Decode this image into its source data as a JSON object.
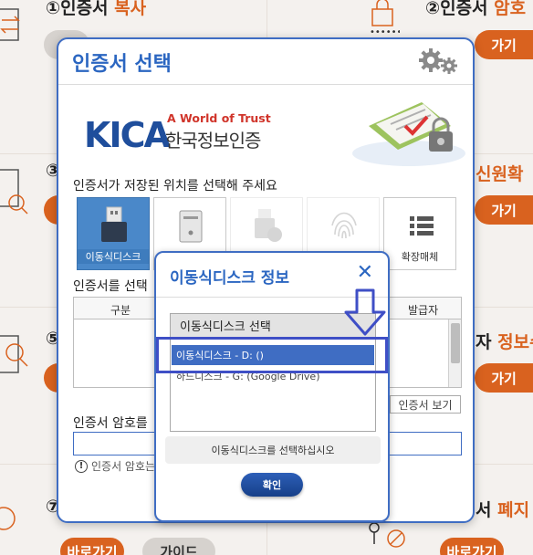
{
  "background": {
    "cells": [
      {
        "num": "①",
        "title": "인증서 ",
        "accent": "복사"
      },
      {
        "num": "②",
        "title": "인증서 ",
        "accent": "암호"
      },
      {
        "num": "③",
        "title": "",
        "accent": ""
      },
      {
        "num": "",
        "title": "",
        "accent": "신원확"
      },
      {
        "num": "⑤",
        "title": "",
        "accent": ""
      },
      {
        "num": "",
        "title": "자 ",
        "accent": "정보수"
      },
      {
        "num": "⑦",
        "title": "",
        "accent": ""
      },
      {
        "num": "",
        "title": "서 ",
        "accent": "폐지"
      }
    ],
    "buttons": {
      "shortcut": "바로가기",
      "guide": "가이드",
      "partial_right": "가기"
    }
  },
  "modal": {
    "title": "인증서 선택",
    "brand": {
      "logo_text": "KICA",
      "slogan": "A World of Trust",
      "org_name": "한국정보인증"
    },
    "location_prompt": "인증서가 저장된 위치를 선택해 주세요",
    "locations": [
      {
        "label": "이동식디스크",
        "icon": "usb-drive-icon",
        "state": "selected"
      },
      {
        "label": "",
        "icon": "hard-disk-icon",
        "state": "normal"
      },
      {
        "label": "",
        "icon": "security-token-icon",
        "state": "disabled"
      },
      {
        "label": "",
        "icon": "fingerprint-icon",
        "state": "disabled"
      },
      {
        "label": "확장매체",
        "icon": "list-icon",
        "state": "normal"
      }
    ],
    "cert_list_label": "인증서를 선택",
    "table_headers": {
      "col1": "구분",
      "col_last": "발급자"
    },
    "view_cert_button": "인증서 보기",
    "password_label": "인증서 암호를",
    "password_note": "인증서 암호는"
  },
  "sub_dialog": {
    "title": "이동식디스크 정보",
    "list_header": "이동식디스크 선택",
    "items": [
      {
        "label": "이동식디스크 - D: ()",
        "selected": true
      },
      {
        "label": "하드디스크 - G: (Google Drive)",
        "selected": false
      }
    ],
    "hint": "이동식디스크를 선택하십시오",
    "ok_button": "확인"
  },
  "colors": {
    "accent_blue": "#2b66c1",
    "accent_orange": "#d9621f",
    "highlight": "#3f4fc6"
  }
}
